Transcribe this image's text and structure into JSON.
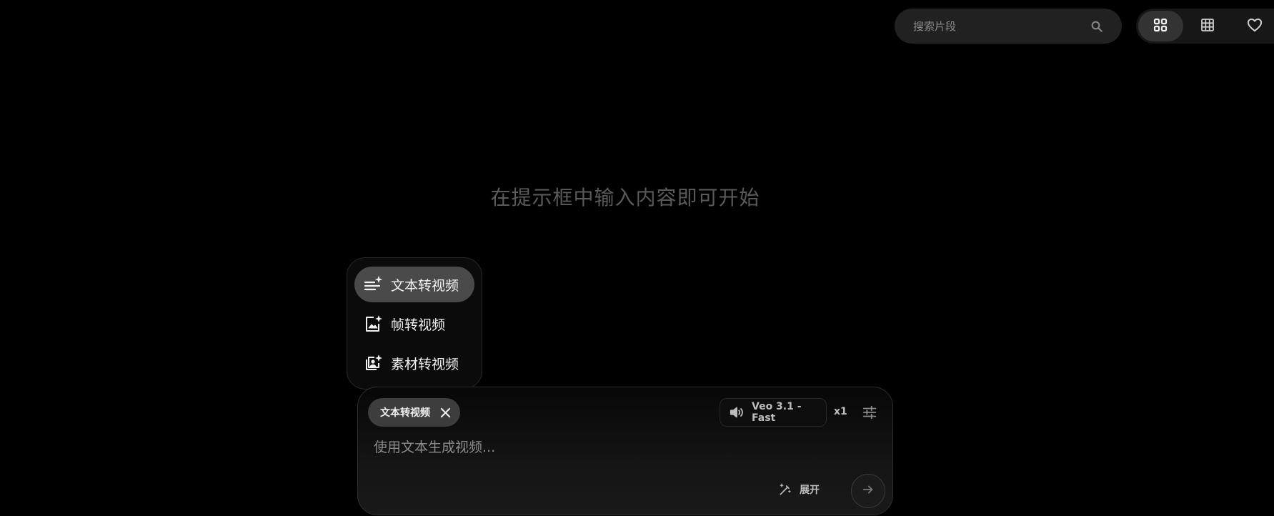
{
  "header": {
    "search": {
      "placeholder": "搜索片段",
      "icon": "search-icon"
    },
    "view_toggle": [
      {
        "name": "grid-large-view",
        "icon": "grid-2x2-icon",
        "active": true
      },
      {
        "name": "grid-small-view",
        "icon": "grid-3x3-icon",
        "active": false
      },
      {
        "name": "favorites-view",
        "icon": "heart-icon",
        "active": false
      }
    ]
  },
  "main": {
    "empty_hint": "在提示框中输入内容即可开始"
  },
  "mode_menu": {
    "items": [
      {
        "label": "文本转视频",
        "icon": "text-sparkle-icon",
        "active": true
      },
      {
        "label": "帧转视频",
        "icon": "image-sparkle-icon",
        "active": false
      },
      {
        "label": "素材转视频",
        "icon": "assets-sparkle-icon",
        "active": false
      }
    ]
  },
  "prompt": {
    "mode_chip": {
      "label": "文本转视频",
      "icon": "close-icon"
    },
    "model": {
      "label": "Veo 3.1 - Fast",
      "icon": "speaker-icon"
    },
    "count": "x1",
    "settings_icon": "sliders-icon",
    "input": {
      "value": "",
      "placeholder": "使用文本生成视频..."
    },
    "expand": {
      "label": "展开",
      "icon": "magic-wand-icon"
    },
    "send_icon": "arrow-right-icon"
  },
  "colors": {
    "background": "#000000",
    "surface": "#212121",
    "active_item": "#4a4a4a",
    "muted_text": "#5a5a5a"
  }
}
